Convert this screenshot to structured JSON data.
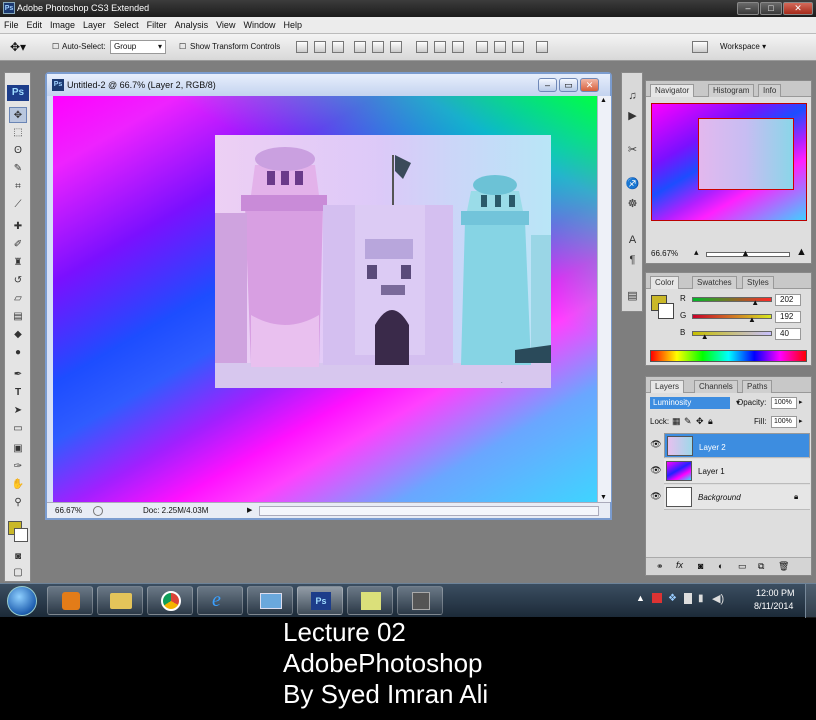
{
  "window": {
    "title": "Adobe Photoshop CS3 Extended",
    "icon_label": "Ps"
  },
  "menu": [
    "File",
    "Edit",
    "Image",
    "Layer",
    "Select",
    "Filter",
    "Analysis",
    "View",
    "Window",
    "Help"
  ],
  "options": {
    "auto_select_label": "Auto-Select:",
    "auto_select_value": "Group",
    "show_transform_label": "Show Transform Controls",
    "workspace_label": "Workspace ▾"
  },
  "toolbox": {
    "logo": "Ps"
  },
  "document": {
    "title": "Untitled-2 @ 66.7% (Layer 2, RGB/8)",
    "zoom": "66.67%",
    "doc_info": "Doc: 2.25M/4.03M"
  },
  "navigator": {
    "tabs": [
      "Navigator",
      "Histogram",
      "Info"
    ],
    "zoom": "66.67%"
  },
  "color_panel": {
    "tabs": [
      "Color",
      "Swatches",
      "Styles"
    ],
    "channels": [
      {
        "label": "R",
        "value": "202",
        "level": 0.79
      },
      {
        "label": "G",
        "value": "192",
        "level": 0.75
      },
      {
        "label": "B",
        "value": "40",
        "level": 0.16
      }
    ],
    "foreground_color": "#cab828"
  },
  "layers_panel": {
    "tabs": [
      "Layers",
      "Channels",
      "Paths"
    ],
    "blend_mode": "Luminosity",
    "opacity_label": "Opacity:",
    "opacity": "100%",
    "lock_label": "Lock:",
    "fill_label": "Fill:",
    "fill": "100%",
    "layers": [
      {
        "name": "Layer 2",
        "selected": true
      },
      {
        "name": "Layer 1",
        "selected": false
      },
      {
        "name": "Background",
        "selected": false
      }
    ]
  },
  "taskbar": {
    "time": "12:00 PM",
    "date": "8/11/2014",
    "apps": [
      "start-orb",
      "media-player",
      "file-explorer",
      "chrome",
      "internet-explorer",
      "windows-explorer",
      "photoshop",
      "sticky-notes",
      "movie-maker"
    ]
  },
  "caption": {
    "line1": "Lecture 02",
    "line2": "AdobePhotoshop",
    "line3": "By Syed Imran Ali"
  }
}
